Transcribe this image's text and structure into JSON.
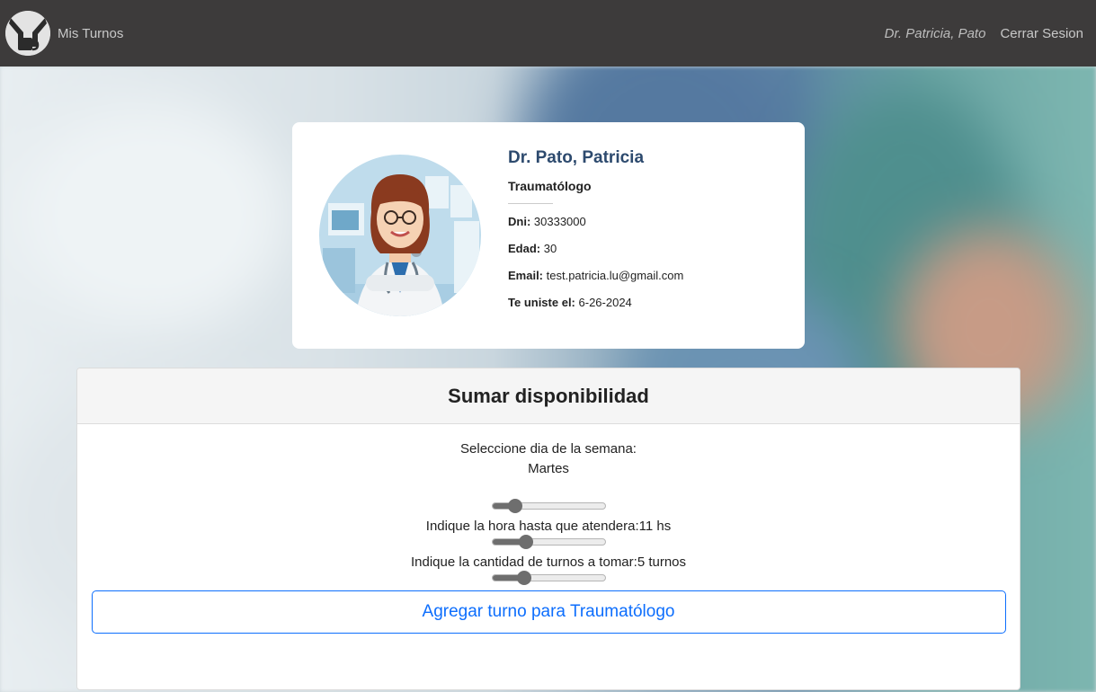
{
  "navbar": {
    "brand": "Mis Turnos",
    "user": "Dr. Patricia, Pato",
    "logout": "Cerrar Sesion"
  },
  "profile": {
    "name": "Dr. Pato, Patricia",
    "specialty": "Traumatólogo",
    "dni_label": "Dni:",
    "dni": "30333000",
    "age_label": "Edad:",
    "age": "30",
    "email_label": "Email:",
    "email": "test.patricia.lu@gmail.com",
    "joined_label": "Te uniste el:",
    "joined": "6-26-2024"
  },
  "availability": {
    "title": "Sumar disponibilidad",
    "day_label": "Seleccione dia de la semana:",
    "day_value": "Martes",
    "day_slider": 0.2,
    "hour_label": "Indique la hora hasta que atendera:11 hs",
    "hour_slider": 0.3,
    "turns_label": "Indique la cantidad de turnos a tomar:5 turnos",
    "turns_slider": 0.28,
    "add_button": "Agregar turno para Traumatólogo"
  },
  "colors": {
    "navbar": "#3d3b3b",
    "doctor_name": "#2d4a6e",
    "button_accent": "#0d6efd"
  }
}
